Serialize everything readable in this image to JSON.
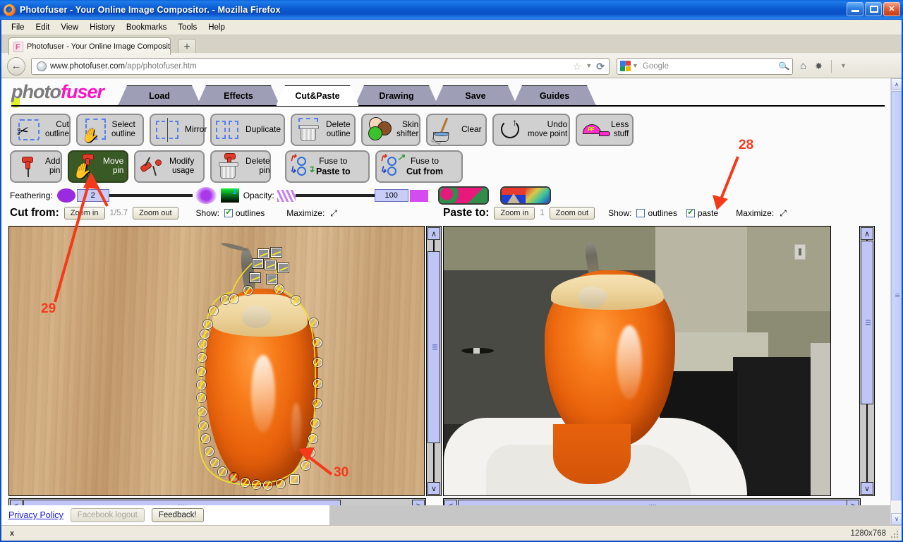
{
  "window": {
    "title": "Photofuser - Your Online Image Compositor. - Mozilla Firefox",
    "minimize_label": "Minimize",
    "maximize_label": "Maximize",
    "close_label": "Close"
  },
  "menubar": {
    "items": [
      "File",
      "Edit",
      "View",
      "History",
      "Bookmarks",
      "Tools",
      "Help"
    ]
  },
  "tabstrip": {
    "tab_title": "Photofuser - Your Online Image Compositor.",
    "new_tab_label": "+"
  },
  "navbar": {
    "back_label": "←",
    "url": "www.photofuser.com/app/photofuser.htm",
    "url_domain": "www.photofuser.com",
    "url_path": "/app/photofuser.htm",
    "bookmark_star": "☆",
    "dropdown_caret": "▼",
    "reload_label": "⟳",
    "search_engine": "Google",
    "search_value": "",
    "search_placeholder": "Google",
    "home_label": "⌂",
    "plugin_label": "✸"
  },
  "app": {
    "logo_part1": "photo",
    "logo_part2": "fuser",
    "tabs": [
      {
        "label": "Load",
        "active": false
      },
      {
        "label": "Effects",
        "active": false
      },
      {
        "label": "Cut&Paste",
        "active": true
      },
      {
        "label": "Drawing",
        "active": false
      },
      {
        "label": "Save",
        "active": false
      },
      {
        "label": "Guides",
        "active": false
      }
    ],
    "toolrow1": [
      {
        "name": "cut-outline",
        "l1": "Cut",
        "l2": "outline",
        "icon": "scissors-dashbox-icon",
        "active": false
      },
      {
        "name": "select-outline",
        "l1": "Select",
        "l2": "outline",
        "icon": "hand-dashbox-icon",
        "active": false
      },
      {
        "name": "mirror",
        "l1": "Mirror",
        "l2": "",
        "icon": "mirror-icon",
        "active": false
      },
      {
        "name": "duplicate",
        "l1": "Duplicate",
        "l2": "",
        "icon": "duplicate-icon",
        "active": false
      },
      {
        "name": "delete-outline",
        "l1": "Delete",
        "l2": "outline",
        "icon": "trash-dashbox-icon",
        "active": false
      },
      {
        "name": "skin-shifter",
        "l1": "Skin",
        "l2": "shifter",
        "icon": "smiley-faces-icon",
        "active": false
      },
      {
        "name": "clear",
        "l1": "Clear",
        "l2": "",
        "icon": "broom-bucket-icon",
        "active": false
      },
      {
        "name": "undo-move-point",
        "l1": "Undo",
        "l2": "move point",
        "icon": "undo-circle-arrow-icon",
        "active": false
      },
      {
        "name": "less-stuff",
        "l1": "Less",
        "l2": "stuff",
        "icon": "pink-cap-icon",
        "active": false
      }
    ],
    "toolrow2": [
      {
        "name": "add-pin",
        "l1": "Add",
        "l2": "pin",
        "icon": "pin-icon",
        "active": false
      },
      {
        "name": "move-pin",
        "l1": "Move",
        "l2": "pin",
        "icon": "hand-pin-icon",
        "active": true
      },
      {
        "name": "modify-usage",
        "l1": "Modify",
        "l2": "usage",
        "icon": "two-pins-icon",
        "active": false
      },
      {
        "name": "delete-pin",
        "l1": "Delete",
        "l2": "pin",
        "icon": "trash-pin-icon",
        "active": false
      },
      {
        "name": "fuse-to-paste-to",
        "l1": "Fuse to",
        "l2": "Paste to",
        "icon": "fuse-arrows-icon",
        "active": false
      },
      {
        "name": "fuse-to-cut-from",
        "l1": "Fuse to",
        "l2": "Cut from",
        "icon": "fuse-arrows-icon",
        "active": false
      }
    ],
    "sliders": {
      "feathering_label": "Feathering:",
      "feathering_value": "2",
      "opacity_label": "Opacity:",
      "opacity_value": "100"
    },
    "cut_from": {
      "label": "Cut from:",
      "zoom_in": "Zoom in",
      "zoom_out": "Zoom out",
      "zoom_level": "1/5.7",
      "show_label": "Show:",
      "outlines_label": "outlines",
      "outlines_checked": true,
      "maximize_label": "Maximize:"
    },
    "paste_to": {
      "label": "Paste to:",
      "zoom_in": "Zoom in",
      "zoom_out": "Zoom out",
      "zoom_level": "1",
      "show_label": "Show:",
      "outlines_label": "outlines",
      "outlines_checked": false,
      "paste_label": "paste",
      "paste_checked": true,
      "maximize_label": "Maximize:"
    },
    "footer": {
      "privacy_policy": "Privacy Policy",
      "facebook_logout": "Facebook logout",
      "feedback": "Feedback!"
    }
  },
  "statusbar": {
    "left_text": "x",
    "right_text": "1280x768"
  },
  "annotations": [
    {
      "id": "28",
      "label": "28",
      "points_to": "paste-checkbox"
    },
    {
      "id": "29",
      "label": "29",
      "points_to": "move-pin-button"
    },
    {
      "id": "30",
      "label": "30",
      "points_to": "outline-node-bottom"
    }
  ]
}
